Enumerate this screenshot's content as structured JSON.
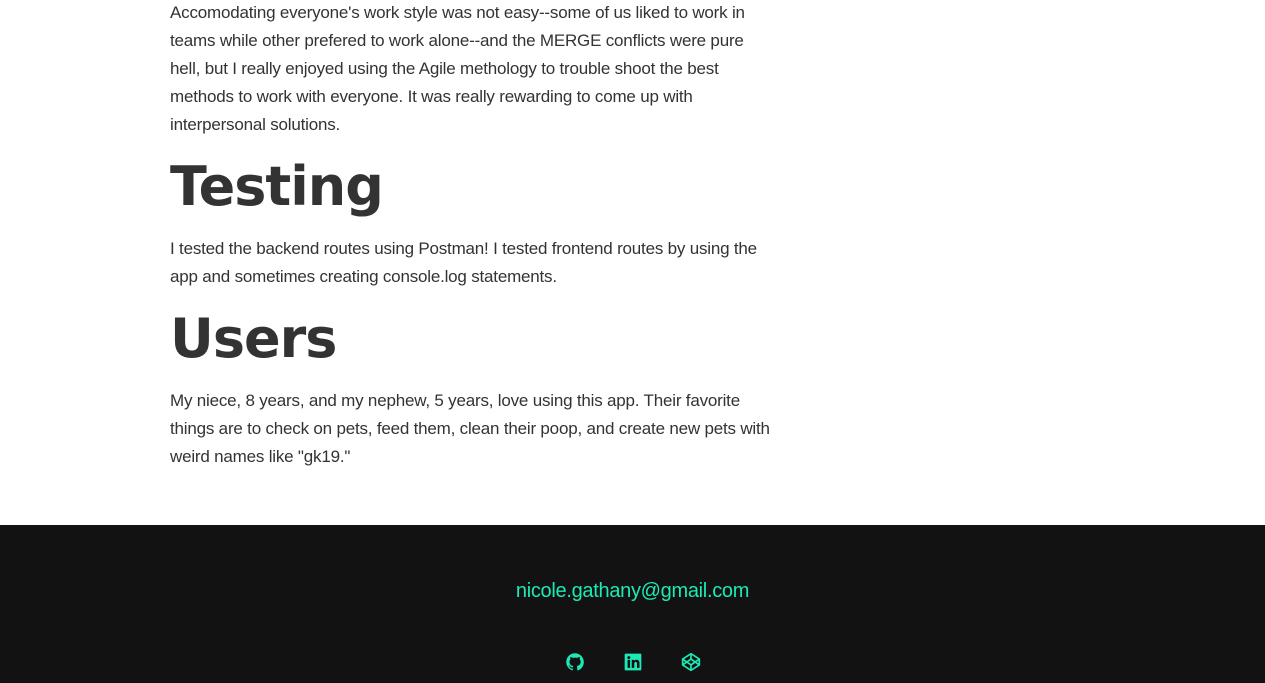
{
  "content": {
    "paragraph_1": "Accomodating everyone's work style was not easy--some of us liked to work in teams while other prefered to work alone--and the MERGE conflicts were pure hell, but I really enjoyed using the Agile methology to trouble shoot the best methods to work with everyone. It was really rewarding to come up with interpersonal solutions.",
    "testing_heading": "Testing",
    "testing_text": "I tested the backend routes using Postman! I tested frontend routes by using the app and sometimes creating console.log statements.",
    "users_heading": "Users",
    "users_text": "My niece, 8 years, and my nephew, 5 years, love using this app. Their favorite things are to check on pets, feed them, clean their poop, and create new pets with weird names like \"gk19.\""
  },
  "footer": {
    "email": "nicole.gathany@gmail.com",
    "social_icons": [
      "github-icon",
      "linkedin-icon",
      "codepen-icon"
    ],
    "accent_color": "#1de9b6",
    "background_color": "#121212"
  }
}
